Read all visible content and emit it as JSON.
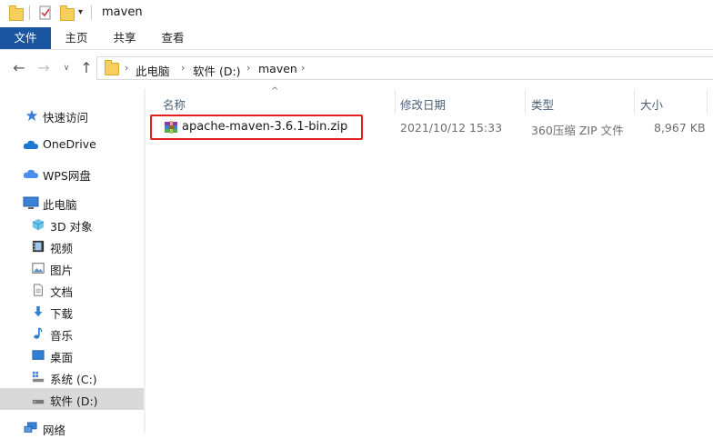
{
  "window": {
    "title": "maven"
  },
  "ribbon": {
    "tabs": [
      {
        "label": "文件"
      },
      {
        "label": "主页"
      },
      {
        "label": "共享"
      },
      {
        "label": "查看"
      }
    ]
  },
  "address": {
    "crumbs": [
      "此电脑",
      "软件 (D:)",
      "maven"
    ]
  },
  "sidebar": {
    "items": [
      {
        "label": "快速访问",
        "icon": "star-icon"
      },
      {
        "label": "OneDrive",
        "icon": "cloud-icon"
      },
      {
        "label": "WPS网盘",
        "icon": "wps-cloud-icon"
      },
      {
        "label": "此电脑",
        "icon": "computer-icon"
      },
      {
        "label": "3D 对象",
        "icon": "3d-objects-icon"
      },
      {
        "label": "视频",
        "icon": "video-icon"
      },
      {
        "label": "图片",
        "icon": "pictures-icon"
      },
      {
        "label": "文档",
        "icon": "documents-icon"
      },
      {
        "label": "下载",
        "icon": "download-icon"
      },
      {
        "label": "音乐",
        "icon": "music-icon"
      },
      {
        "label": "桌面",
        "icon": "desktop-icon"
      },
      {
        "label": "系统 (C:)",
        "icon": "drive-icon"
      },
      {
        "label": "软件 (D:)",
        "icon": "drive-icon",
        "selected": true
      },
      {
        "label": "网络",
        "icon": "network-icon"
      }
    ]
  },
  "columns": {
    "name": "名称",
    "date": "修改日期",
    "type": "类型",
    "size": "大小"
  },
  "files": [
    {
      "name": "apache-maven-3.6.1-bin.zip",
      "date": "2021/10/12 15:33",
      "type": "360压缩 ZIP 文件",
      "size": "8,967 KB",
      "icon": "zip-archive-icon"
    }
  ],
  "colors": {
    "file_tab": "#19569f",
    "highlight": "#e02020",
    "selected_bg": "#d9d9d9"
  }
}
